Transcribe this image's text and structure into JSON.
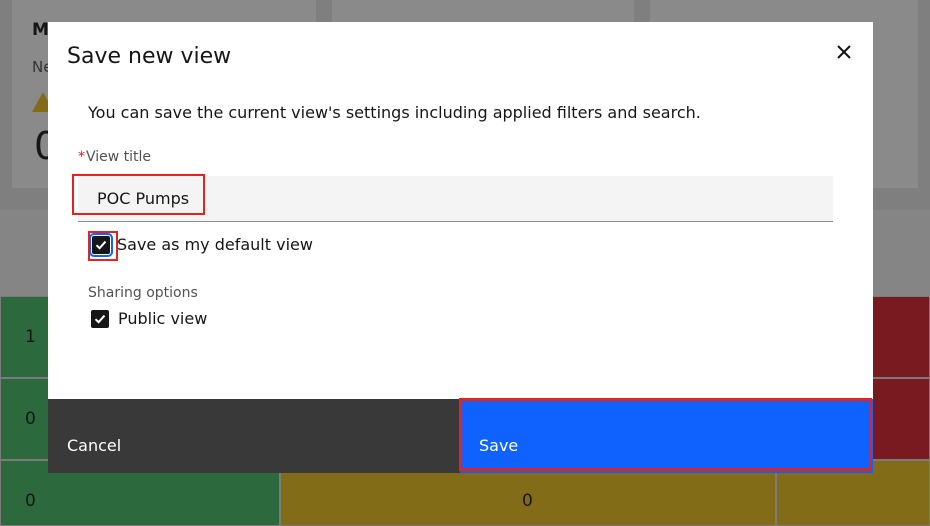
{
  "background": {
    "cards": [
      {
        "title": "M",
        "subtitle": "Ne",
        "value": "0"
      },
      {
        "title": "",
        "subtitle": "",
        "value": ""
      },
      {
        "title": "",
        "subtitle": "",
        "value": ""
      }
    ],
    "grid_values": [
      "1",
      "0",
      "0",
      "0"
    ]
  },
  "modal": {
    "title": "Save new view",
    "close_icon": "close-icon",
    "description": "You can save the current view's settings including applied filters and search.",
    "view_title": {
      "required_mark": "*",
      "label": "View title",
      "value": "POC Pumps"
    },
    "default_view": {
      "label": "Save as my default view",
      "checked": true
    },
    "sharing": {
      "label": "Sharing options",
      "public_view": {
        "label": "Public view",
        "checked": true
      }
    },
    "buttons": {
      "cancel": "Cancel",
      "save": "Save"
    }
  },
  "colors": {
    "primary": "#0f62fe",
    "secondary": "#393939",
    "highlight": "#e5221b",
    "status_green": "#42be65",
    "status_yellow": "#f1c21b",
    "status_red": "#da1e28"
  }
}
